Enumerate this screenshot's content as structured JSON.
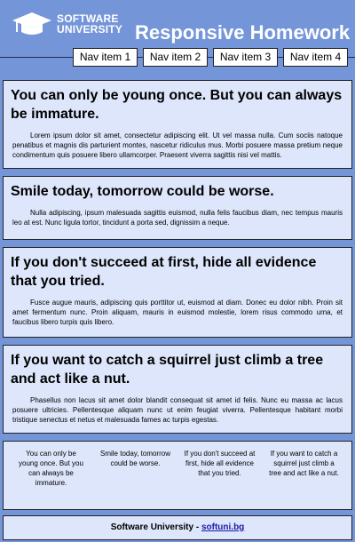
{
  "header": {
    "logo_line1": "SOFTWARE",
    "logo_line2": "UNIVERSITY",
    "title": "Responsive Homework"
  },
  "nav": {
    "items": [
      "Nav item 1",
      "Nav item 2",
      "Nav item 3",
      "Nav item 4"
    ]
  },
  "articles": [
    {
      "heading": "You can only be young once. But you can always be immature.",
      "body": "Lorem ipsum dolor sit amet, consectetur adipiscing elit. Ut vel massa nulla. Cum sociis natoque penatibus et magnis dis parturient montes, nascetur ridiculus mus. Morbi posuere massa pretium neque condimentum quis posuere libero ullamcorper. Praesent viverra sagittis nisi vel mattis."
    },
    {
      "heading": "Smile today, tomorrow could be worse.",
      "body": "Nulla adipiscing, ipsum malesuada sagittis euismod, nulla felis faucibus diam, nec tempus mauris leo at est. Nunc ligula tortor, tincidunt a porta sed, dignissim a neque."
    },
    {
      "heading": "If you don't succeed at first, hide all evidence that you tried.",
      "body": "Fusce augue mauris, adipiscing quis porttitor ut, euismod at diam. Donec eu dolor nibh. Proin sit amet fermentum nunc. Proin aliquam, mauris in euismod molestie, lorem risus commodo urna, et faucibus libero turpis quis libero."
    },
    {
      "heading": "If you want to catch a squirrel just climb a tree and act like a nut.",
      "body": "Phasellus non lacus sit amet dolor blandit consequat sit amet id felis. Nunc eu massa ac lacus posuere ultricies. Pellentesque aliquam nunc ut enim feugiat viverra. Pellentesque habitant morbi tristique senectus et netus et malesuada fames ac turpis egestas."
    }
  ],
  "summary": [
    "You can only be young once. But you can always be immature.",
    "Smile today, tomorrow could be worse.",
    "If you don't succeed at first, hide all evidence that you tried.",
    "If you want to catch a squirrel just climb a tree and act like a nut."
  ],
  "footer": {
    "text": "Software University - ",
    "link": "softuni.bg"
  },
  "colors": {
    "background": "#7496d8",
    "section": "#dde6fa",
    "link": "#1a1aaa"
  }
}
